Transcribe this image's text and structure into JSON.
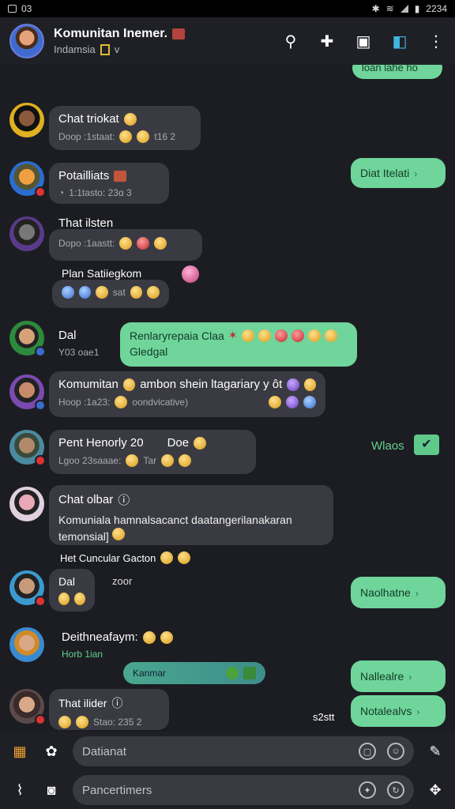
{
  "status": {
    "time": "03",
    "right": "2234"
  },
  "header": {
    "title": "Komunitan Inemer.",
    "subtitle": "Indamsia",
    "subtitle_extra": "v"
  },
  "messages": [
    {
      "name": "Chat triokat",
      "meta": "Doop :1staat:",
      "meta2": "t16  2"
    },
    {
      "name": "Potailliats",
      "meta": "1:1tasto: 23ɑ  3"
    },
    {
      "name": "That ilsten",
      "meta": "Dopo :1aastt:"
    },
    {
      "name": "Plan Satiiegkom",
      "meta": "sat"
    },
    {
      "name": "Dal",
      "meta": "Y03 oae1"
    },
    {
      "name": "Komumitan",
      "name_suffix": "ambon shein ltagariary y ôt",
      "meta": "Hoop :1a23:",
      "meta2": "oondvicative)"
    },
    {
      "name": "Pent  Henorly 20",
      "name_suffix": "Doe",
      "meta": "Lgoo 23saaae:",
      "meta2": "Tar"
    },
    {
      "name": "Chat olbar",
      "body": "Komuniala hamnalsacanct daatangerilanakaran temonsial]"
    },
    {
      "name": "Het Cuncular  Gacton"
    },
    {
      "name": "Dal",
      "name_suffix": "zoor"
    },
    {
      "name": "Deithneafaym:",
      "meta": "Horb  1ian"
    },
    {
      "name": "That ilider",
      "meta": "Stao: 235  2"
    }
  ],
  "outgoing": [
    {
      "text": "loan lahe ho"
    },
    {
      "text": "Diat Itelati"
    },
    {
      "text": "Renlaryrepaia Claa",
      "text2": "Gledgal"
    },
    {
      "text": "Naolhatne"
    },
    {
      "text": "Nallealre"
    },
    {
      "text": "Notalealvs"
    }
  ],
  "labels": {
    "wloos": "Wlaos",
    "kanar": "Kanmar",
    "time_bottom": "s2stt"
  },
  "input": {
    "placeholder1": "Datianat",
    "placeholder2": "Pancertimers"
  }
}
